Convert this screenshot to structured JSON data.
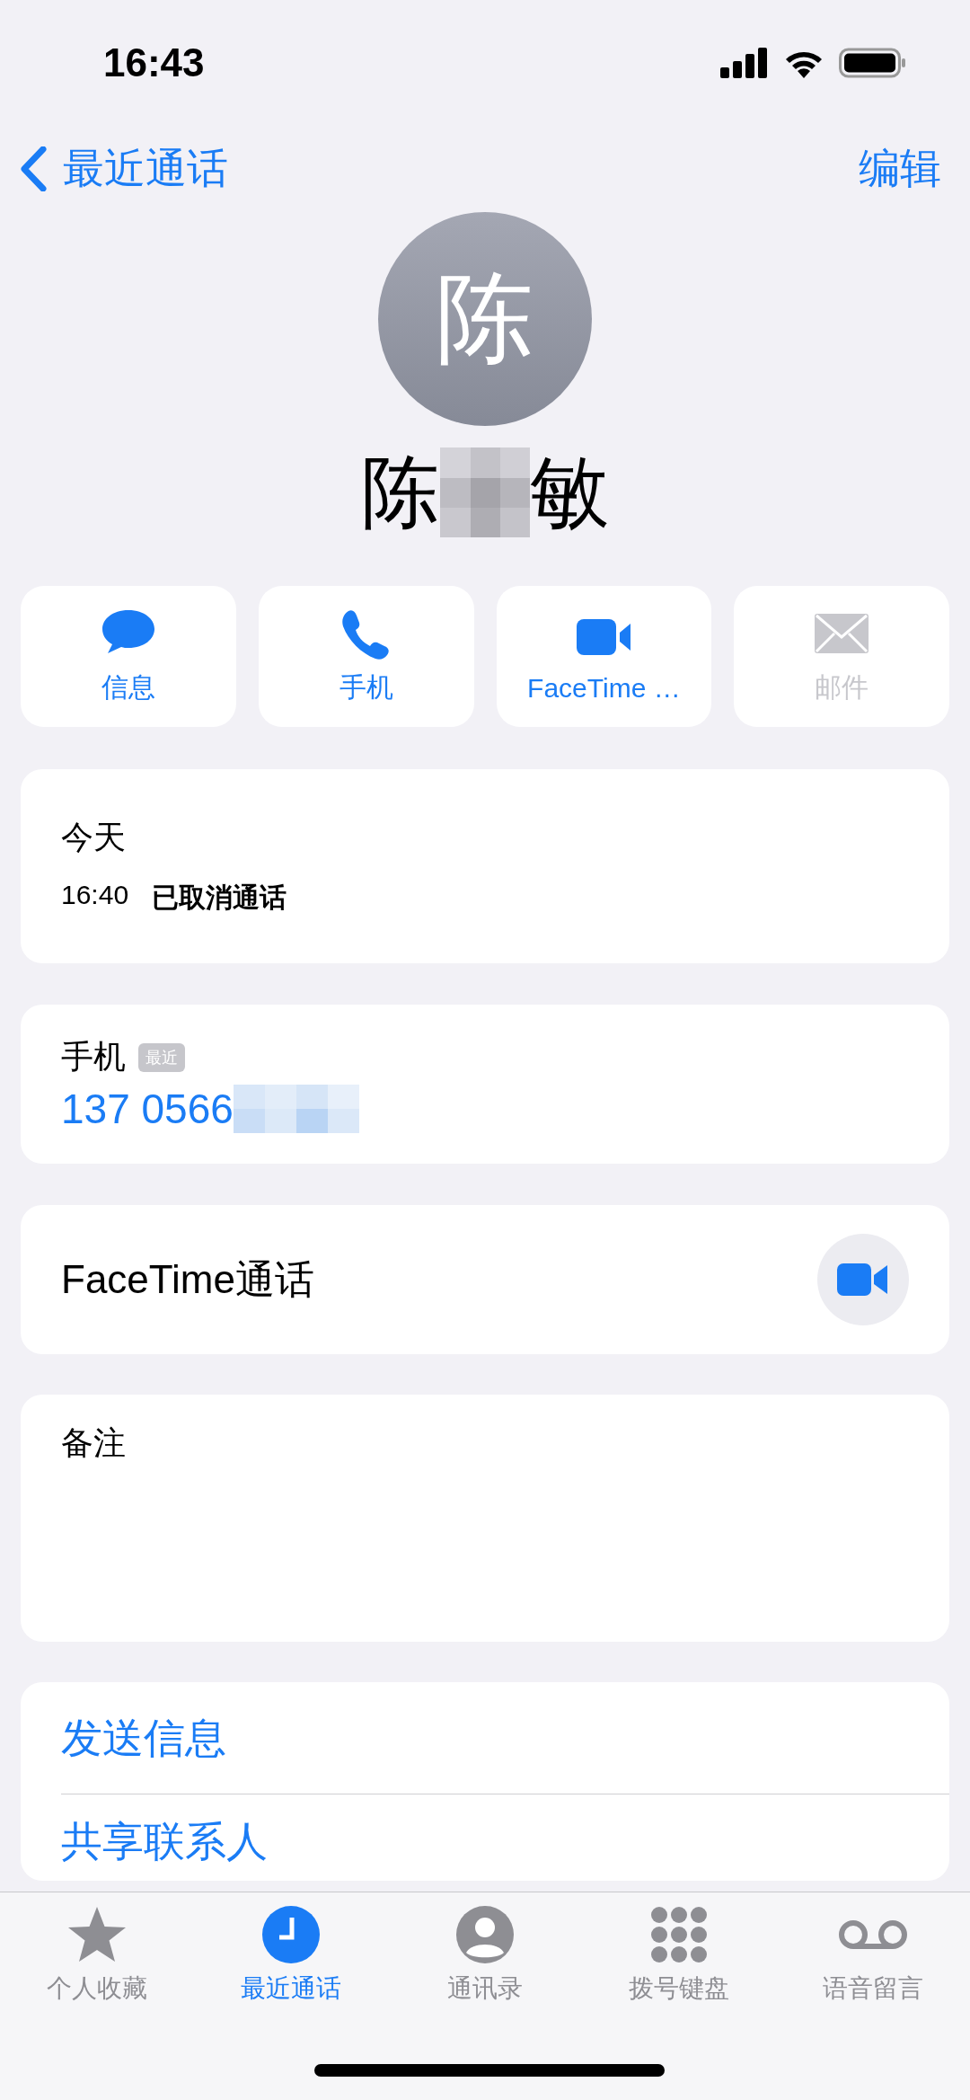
{
  "status_bar": {
    "time": "16:43"
  },
  "nav": {
    "back": "最近通话",
    "edit": "编辑"
  },
  "contact": {
    "initial": "陈",
    "name_before": "陈",
    "name_after": "敏",
    "redacted": true
  },
  "actions": [
    {
      "kind": "message",
      "label": "信息",
      "disabled": false
    },
    {
      "kind": "phone",
      "label": "手机",
      "disabled": false
    },
    {
      "kind": "video",
      "label": "FaceTime …",
      "disabled": false
    },
    {
      "kind": "mail",
      "label": "邮件",
      "disabled": true
    }
  ],
  "call_log": {
    "day": "今天",
    "time": "16:40",
    "status": "已取消通话"
  },
  "phone": {
    "label": "手机",
    "badge": "最近",
    "number": "137 0566",
    "redacted": true
  },
  "facetime": {
    "label": "FaceTime通话"
  },
  "notes": {
    "label": "备注"
  },
  "links": [
    "发送信息",
    "共享联系人"
  ],
  "tabs": [
    {
      "kind": "star",
      "label": "个人收藏",
      "selected": false
    },
    {
      "kind": "clock",
      "label": "最近通话",
      "selected": true
    },
    {
      "kind": "person",
      "label": "通讯录",
      "selected": false
    },
    {
      "kind": "keypad",
      "label": "拨号键盘",
      "selected": false
    },
    {
      "kind": "voicemail",
      "label": "语音留言",
      "selected": false
    }
  ]
}
